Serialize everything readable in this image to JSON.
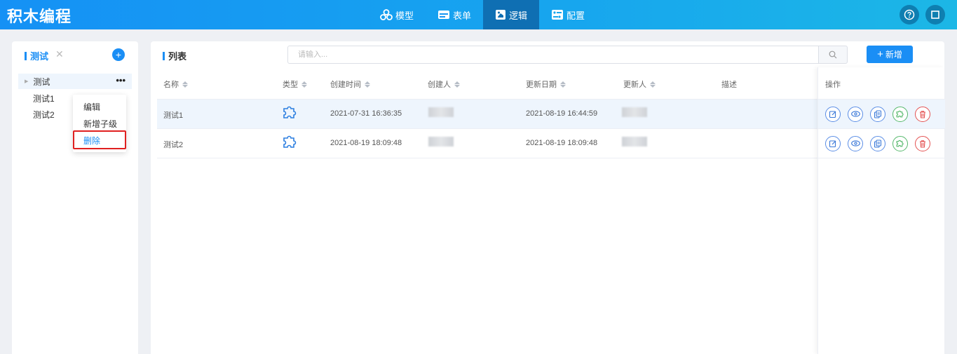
{
  "app": {
    "logo": "积木编程",
    "nav": [
      {
        "label": "模型",
        "icon": "model-icon"
      },
      {
        "label": "表单",
        "icon": "form-icon"
      },
      {
        "label": "逻辑",
        "icon": "logic-icon",
        "active": true
      },
      {
        "label": "配置",
        "icon": "config-icon"
      }
    ],
    "help_icon": "question-circle-icon",
    "window_icon": "square-icon"
  },
  "sidebar": {
    "title": "测试",
    "tree": {
      "root": "测试",
      "children": [
        "测试1",
        "测试2"
      ]
    },
    "context_menu": [
      "编辑",
      "新增子级",
      "删除"
    ]
  },
  "main": {
    "title": "列表",
    "search_placeholder": "请输入...",
    "add_label": "新增",
    "columns": [
      "名称",
      "类型",
      "创建时间",
      "创建人",
      "更新日期",
      "更新人",
      "描述",
      "操作"
    ],
    "rows": [
      {
        "name": "测试1",
        "type_icon": "puzzle-icon",
        "created": "2021-07-31 16:36:35",
        "updated": "2021-08-19 16:44:59"
      },
      {
        "name": "测试2",
        "type_icon": "puzzle-icon",
        "created": "2021-08-19 18:09:48",
        "updated": "2021-08-19 18:09:48"
      }
    ],
    "operations": [
      "edit-icon",
      "view-icon",
      "copy-icon",
      "puzzle-icon",
      "delete-icon"
    ]
  },
  "colors": {
    "primary": "#1a8ef5",
    "header_gradient_start": "#1591f5",
    "header_gradient_end": "#1cb7e6",
    "danger": "#e45252",
    "success": "#55b86b"
  }
}
